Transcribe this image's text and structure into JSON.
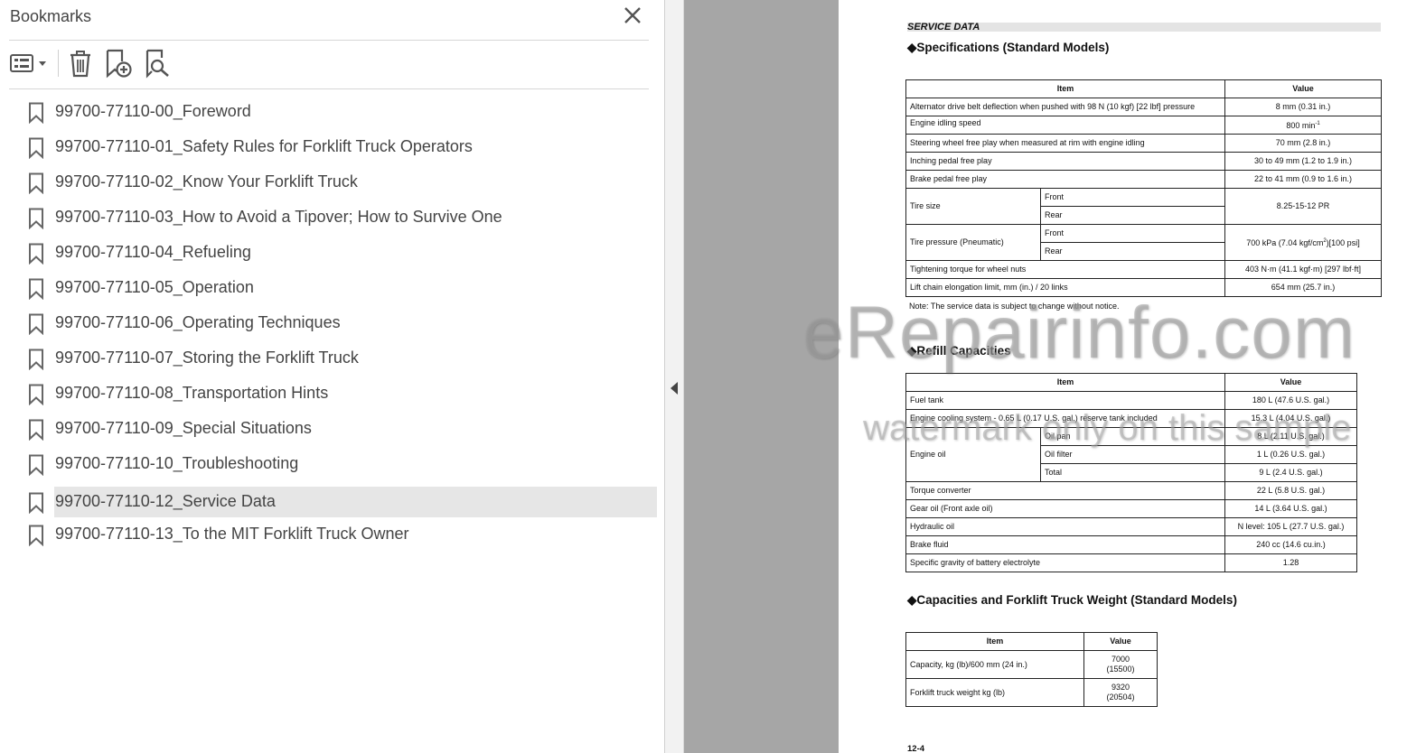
{
  "bookmarks_panel": {
    "title": "Bookmarks",
    "items": [
      {
        "label": "99700-77110-00_Foreword",
        "selected": false
      },
      {
        "label": "99700-77110-01_Safety Rules for Forklift Truck Operators",
        "selected": false
      },
      {
        "label": "99700-77110-02_Know Your Forklift Truck",
        "selected": false
      },
      {
        "label": "99700-77110-03_How to Avoid a Tipover; How to Survive One",
        "selected": false
      },
      {
        "label": "99700-77110-04_Refueling",
        "selected": false
      },
      {
        "label": "99700-77110-05_Operation",
        "selected": false
      },
      {
        "label": "99700-77110-06_Operating Techniques",
        "selected": false
      },
      {
        "label": "99700-77110-07_Storing the Forklift Truck",
        "selected": false
      },
      {
        "label": "99700-77110-08_Transportation Hints",
        "selected": false
      },
      {
        "label": "99700-77110-09_Special Situations",
        "selected": false
      },
      {
        "label": "99700-77110-10_Troubleshooting",
        "selected": false
      },
      {
        "label": "99700-77110-12_Service Data",
        "selected": true
      },
      {
        "label": "99700-77110-13_To the MIT Forklift Truck Owner",
        "selected": false
      }
    ],
    "toolbar_icons": [
      "options-menu-icon",
      "delete-bookmark-icon",
      "new-bookmark-icon",
      "find-bookmark-icon"
    ]
  },
  "document": {
    "header": "SERVICE DATA",
    "spec_title": "◆Specifications (Standard Models)",
    "spec_table": {
      "col_item": "Item",
      "col_value": "Value",
      "rows": {
        "alt_belt": {
          "item": "Alternator drive belt deflection when pushed with 98 N (10 kgf) [22 lbf] pressure",
          "value": "8 mm (0.31 in.)"
        },
        "idle": {
          "item": "Engine idling speed",
          "value": "800 min",
          "value_sup": "-1"
        },
        "steer": {
          "item": "Steering wheel free play when measured at rim with engine idling",
          "value": "70 mm (2.8 in.)"
        },
        "inching": {
          "item": "Inching pedal free play",
          "value": "30 to 49 mm (1.2 to 1.9 in.)"
        },
        "brake": {
          "item": "Brake pedal free play",
          "value": "22 to 41 mm (0.9 to 1.6 in.)"
        },
        "tire_size": {
          "item": "Tire size",
          "front": "Front",
          "rear": "Rear",
          "value": "8.25-15-12 PR"
        },
        "tire_pressure": {
          "item": "Tire pressure (Pneumatic)",
          "front": "Front",
          "rear": "Rear",
          "value_a": "700 kPa (7.04 kgf/cm",
          "value_sup": "2",
          "value_b": ")[100 psi]"
        },
        "torque": {
          "item": "Tightening torque for wheel nuts",
          "value": "403 N·m (41.1 kgf·m) [297 lbf·ft]"
        },
        "chain": {
          "item": "Lift chain elongation limit, mm (in.) / 20 links",
          "value": "654 mm (25.7 in.)"
        }
      }
    },
    "note": "Note: The service data is subject to change without notice.",
    "refill_title": "◆Refill Capacities",
    "refill_table": {
      "col_item": "Item",
      "col_value": "Value",
      "rows": {
        "fuel": {
          "item": "Fuel tank",
          "value": "180 L (47.6 U.S. gal.)"
        },
        "cooling": {
          "item": "Engine cooling system - 0.65 L (0.17 U.S. gal.) reserve tank included",
          "value": "15.3 L (4.04 U.S. gal.)"
        },
        "engine_oil": {
          "item": "Engine oil",
          "oil_pan": "Oil pan",
          "oil_pan_value": "8 L (2.11 U.S. gal.)",
          "oil_filter": "Oil filter",
          "oil_filter_value": "1 L (0.26 U.S. gal.)",
          "total": "Total",
          "total_value": "9 L (2.4 U.S. gal.)"
        },
        "torque_conv": {
          "item": "Torque converter",
          "value": "22 L (5.8 U.S. gal.)"
        },
        "gear_oil": {
          "item": "Gear oil (Front axle oil)",
          "value": "14 L (3.64 U.S. gal.)"
        },
        "hydraulic": {
          "item": "Hydraulic oil",
          "value": "N level: 105 L (27.7 U.S. gal.)"
        },
        "brake_fluid": {
          "item": "Brake fluid",
          "value": "240 cc (14.6 cu.in.)"
        },
        "battery": {
          "item": "Specific gravity of battery electrolyte",
          "value": "1.28"
        }
      }
    },
    "cap_title": "◆Capacities and Forklift Truck Weight (Standard Models)",
    "cap_table": {
      "col_item": "Item",
      "col_value": "Value",
      "rows": {
        "capacity": {
          "item": "Capacity, kg (lb)/600 mm (24 in.)",
          "value_1": "7000",
          "value_2": "(15500)"
        },
        "weight": {
          "item": "Forklift truck weight  kg (lb)",
          "value_1": "9320",
          "value_2": "(20504)"
        }
      }
    },
    "page_number": "12-4"
  },
  "watermark": {
    "line1": "eRepairinfo.com",
    "line2": "watermark only on this sample"
  },
  "colors": {
    "selected_row": "#e6e6e6",
    "gutter": "#a6a6a6",
    "text": "#444444"
  }
}
